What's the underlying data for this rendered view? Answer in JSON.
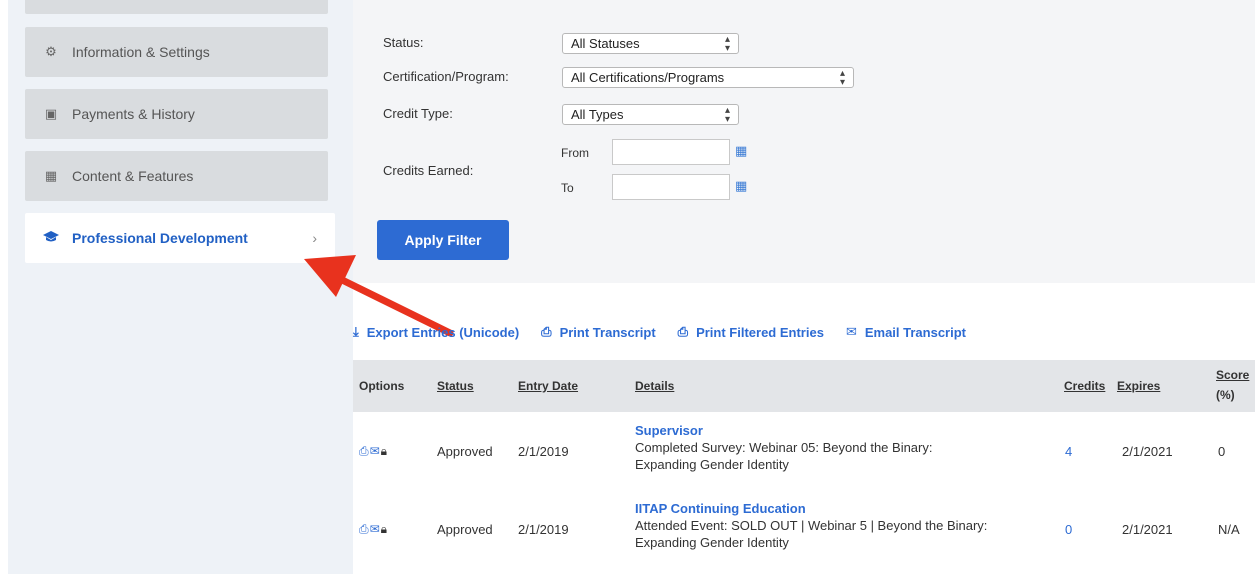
{
  "sidebar": {
    "items": [
      {
        "label": "Information & Settings",
        "icon": "gears-icon"
      },
      {
        "label": "Payments & History",
        "icon": "money-icon"
      },
      {
        "label": "Content & Features",
        "icon": "grid-icon"
      },
      {
        "label": "Professional Development",
        "icon": "graduation-cap-icon",
        "active": true
      }
    ]
  },
  "filters": {
    "status_label": "Status:",
    "status_value": "All Statuses",
    "cert_label": "Certification/Program:",
    "cert_value": "All Certifications/Programs",
    "credit_type_label": "Credit Type:",
    "credit_type_value": "All Types",
    "credits_earned_label": "Credits Earned:",
    "from_label": "From",
    "to_label": "To",
    "apply_label": "Apply Filter"
  },
  "toolbar": {
    "export_label": "Export Entries (Unicode)",
    "print_transcript_label": "Print Transcript",
    "print_filtered_label": "Print Filtered Entries",
    "email_transcript_label": "Email Transcript"
  },
  "table": {
    "headers": {
      "options": "Options",
      "status": "Status",
      "entry_date": "Entry Date",
      "details": "Details",
      "credits": "Credits",
      "expires": "Expires",
      "score_line1": "Score",
      "score_line2": "(%)"
    },
    "rows": [
      {
        "status": "Approved",
        "entry_date": "2/1/2019",
        "title": "Supervisor",
        "detail_line1": "Completed Survey: Webinar 05: Beyond the Binary:",
        "detail_line2": "Expanding Gender Identity",
        "credits": "4",
        "expires": "2/1/2021",
        "score": "0"
      },
      {
        "status": "Approved",
        "entry_date": "2/1/2019",
        "title": "IITAP Continuing Education",
        "detail_line1": "Attended Event: SOLD OUT | Webinar 5 | Beyond the Binary:",
        "detail_line2": "Expanding Gender Identity",
        "credits": "0",
        "expires": "2/1/2021",
        "score": "N/A"
      }
    ]
  },
  "colors": {
    "accent": "#2d6bd3",
    "annotation_arrow": "#e8321e"
  }
}
